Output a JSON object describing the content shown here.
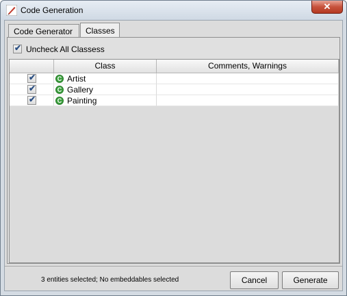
{
  "window": {
    "title": "Code Generation",
    "close_glyph": "✕"
  },
  "tabs": [
    {
      "label": "Code Generator"
    },
    {
      "label": "Classes"
    }
  ],
  "uncheck_all": {
    "label": "Uncheck All Classess",
    "checked": true
  },
  "table": {
    "columns": [
      "",
      "Class",
      "Comments, Warnings"
    ],
    "rows": [
      {
        "checked": true,
        "class": "Artist",
        "comments": ""
      },
      {
        "checked": true,
        "class": "Gallery",
        "comments": ""
      },
      {
        "checked": true,
        "class": "Painting",
        "comments": ""
      }
    ]
  },
  "status_text": "3 entities selected; No embeddables selected",
  "buttons": {
    "cancel": "Cancel",
    "generate": "Generate"
  },
  "check_glyph": "✔",
  "class_icon_glyph": "C"
}
